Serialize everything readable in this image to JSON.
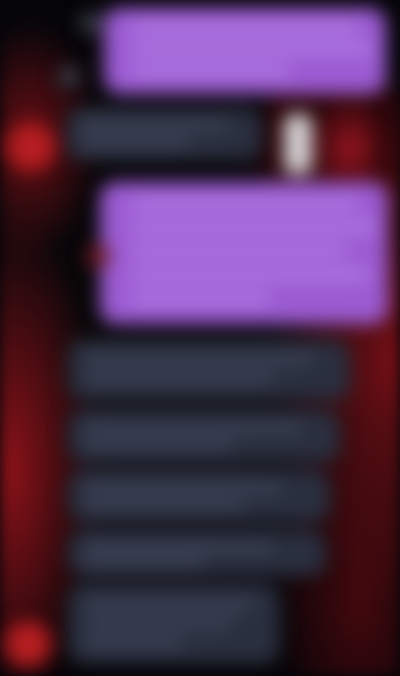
{
  "chat": {
    "colors": {
      "outgoing_bubble": "#9b5bd2",
      "incoming_bubble": "#2a2f3f",
      "avatar": "#b61e22",
      "background": "#050509"
    },
    "messages": [
      {
        "direction": "outgoing",
        "type": "text",
        "text": ""
      },
      {
        "direction": "incoming",
        "type": "text",
        "text": ""
      },
      {
        "direction": "incoming",
        "type": "image"
      },
      {
        "direction": "outgoing",
        "type": "text",
        "text": ""
      },
      {
        "direction": "incoming",
        "type": "text",
        "text": ""
      },
      {
        "direction": "incoming",
        "type": "text",
        "text": ""
      },
      {
        "direction": "incoming",
        "type": "text",
        "text": ""
      },
      {
        "direction": "incoming",
        "type": "text",
        "text": ""
      },
      {
        "direction": "incoming",
        "type": "text",
        "text": ""
      }
    ]
  }
}
